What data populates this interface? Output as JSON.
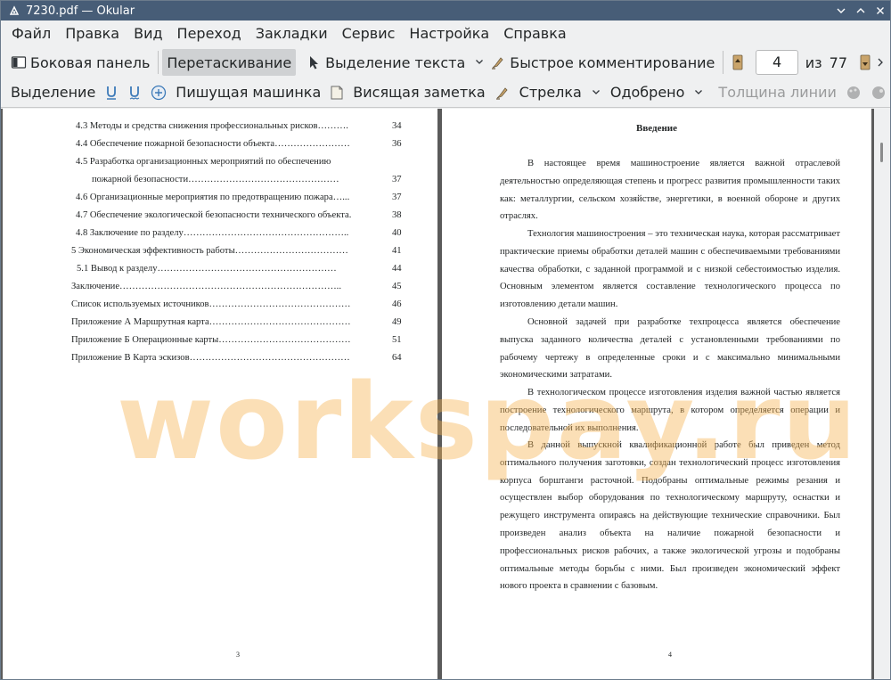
{
  "window": {
    "title": "7230.pdf  — Okular"
  },
  "menubar": [
    "Файл",
    "Правка",
    "Вид",
    "Переход",
    "Закладки",
    "Сервис",
    "Настройка",
    "Справка"
  ],
  "toolbar1": {
    "sidebar": "Боковая панель",
    "drag": "Перетаскивание",
    "text_select": "Выделение текста",
    "quick_comment": "Быстрое комментирование",
    "page_current": "4",
    "page_of": "из",
    "page_total": "77"
  },
  "toolbar2": {
    "selection": "Выделение",
    "typewriter": "Пишущая машинка",
    "hanging_note": "Висящая заметка",
    "arrow": "Стрелка",
    "approved": "Одобрено",
    "line_width": "Толщина линии"
  },
  "left_page": {
    "toc": [
      {
        "text": "4.3 Методы и средства снижения профессиональных рисков……….",
        "page": "34"
      },
      {
        "text": "4.4 Обеспечение пожарной безопасности объекта……………………",
        "page": "36"
      },
      {
        "text": "4.5 Разработка организационных мероприятий по обеспечению",
        "page": ""
      },
      {
        "text": "пожарной безопасности…………………………………………",
        "page": "37"
      },
      {
        "text": "4.6 Организационные мероприятия по предотвращению пожара…...",
        "page": "37"
      },
      {
        "text": "4.7 Обеспечение экологической безопасности технического объекта.",
        "page": "38"
      },
      {
        "text": "4.8 Заключение по разделу……………………………………………..",
        "page": "40"
      },
      {
        "text": "5 Экономическая эффективность работы………………………………",
        "page": "41"
      },
      {
        "text": "5.1 Вывод к разделу…………………………………………………",
        "page": "44"
      },
      {
        "text": "Заключение……………………………………………………………..",
        "page": "45"
      },
      {
        "text": "Список используемых источников………………………………………",
        "page": "46"
      },
      {
        "text": "Приложение А Маршрутная карта………………………………………",
        "page": "49"
      },
      {
        "text": "Приложение Б Операционные карты……………………………………",
        "page": "51"
      },
      {
        "text": "Приложение В Карта эскизов……………………………………………",
        "page": "64"
      }
    ],
    "page_number": "3"
  },
  "right_page": {
    "title": "Введение",
    "paragraphs": [
      "В настоящее время машиностроение является важной отраслевой деятельностью определяющая степень и прогресс развития промышленности таких как: металлургии, сельском хозяйстве, энергетики, в военной обороне и других отраслях.",
      "Технология машиностроения – это техническая наука, которая рассматривает практические приемы обработки деталей машин с обеспечиваемыми требованиями качества обработки, с заданной программой и с низкой себестоимостью изделия. Основным элементом является составление технологического процесса по изготовлению детали машин.",
      "Основной задачей при разработке техпроцесса является обеспечение выпуска заданного количества деталей с установленными требованиями по рабочему чертежу в определенные сроки и с максимально минимальными экономическими затратами.",
      "В технологическом процессе изготовления изделия важной частью является построение технологического маршрута, в котором определяется операции и последовательной их выполнения.",
      "В данной выпускной квалификационной работе был приведен метод оптимального получения заготовки, создан технологический процесс изготовления корпуса борштанги расточной. Подобраны оптимальные режимы резания и осуществлен выбор оборудования по технологическому маршруту, оснастки и режущего инструмента опираясь на действующие технические справочники. Был произведен анализ объекта на наличие пожарной безопасности и профессиональных рисков рабочих, а также экологической угрозы и подобраны оптимальные методы борьбы с ними. Был произведен экономический эффект нового проекта в сравнении с базовым."
    ],
    "page_number": "4"
  },
  "watermark": "workspay.ru"
}
